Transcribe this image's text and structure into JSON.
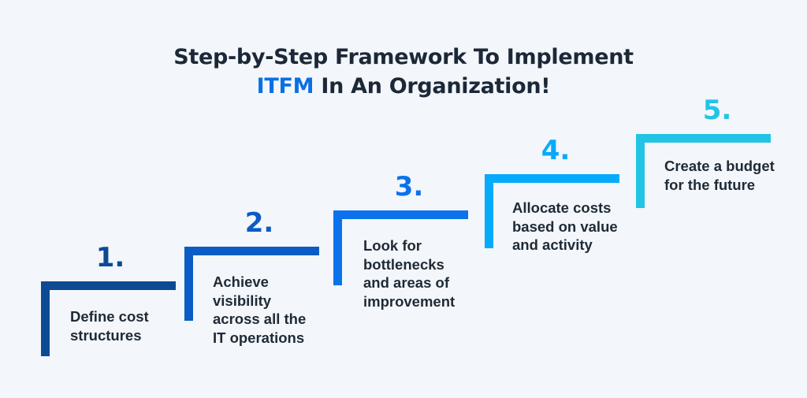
{
  "title": {
    "line1": "Step-by-Step Framework To Implement",
    "accent": "ITFM",
    "line2_rest": " In An Organization!",
    "accent_color": "#0a6fe6",
    "text_color": "#1c2838"
  },
  "steps": [
    {
      "number": "1.",
      "text": "Define cost structures",
      "color": "#0d4a94"
    },
    {
      "number": "2.",
      "text": "Achieve visibility across all the IT operations",
      "color": "#0b5cc4"
    },
    {
      "number": "3.",
      "text": "Look for bottlenecks and areas of improvement",
      "color": "#0a72ec"
    },
    {
      "number": "4.",
      "text": "Allocate costs based on value and activity",
      "color": "#06aafc"
    },
    {
      "number": "5.",
      "text": "Create a budget for the future",
      "color": "#22c4e6"
    }
  ]
}
